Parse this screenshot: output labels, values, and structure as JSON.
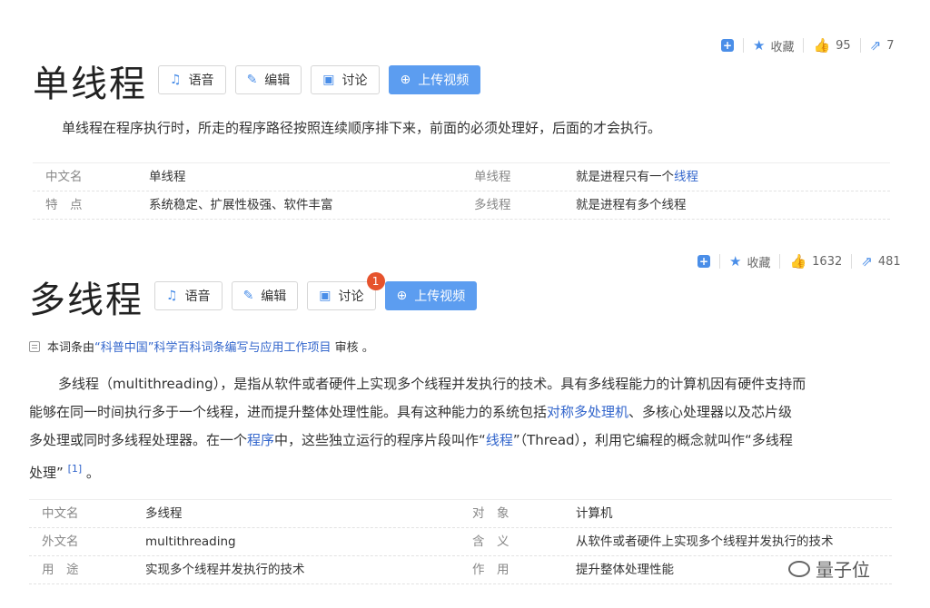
{
  "entry1": {
    "title": "单线程",
    "actions": {
      "add": "+",
      "fav_label": "收藏",
      "like_count": "95",
      "share_count": "7"
    },
    "buttons": {
      "voice": "语音",
      "edit": "编辑",
      "discuss": "讨论",
      "upload": "上传视频"
    },
    "summary": "单线程在程序执行时，所走的程序路径按照连续顺序排下来，前面的必须处理好，后面的才会执行。",
    "info": [
      {
        "k1": "中文名",
        "v1": "单线程",
        "k2": "单线程",
        "v2_pre": "就是进程只有一个",
        "v2_link": "线程"
      },
      {
        "k1": "特　点",
        "v1": "系统稳定、扩展性极强、软件丰富",
        "k2": "多线程",
        "v2_pre": "就是进程有多个线程",
        "v2_link": ""
      }
    ]
  },
  "entry2": {
    "title": "多线程",
    "actions": {
      "add": "+",
      "fav_label": "收藏",
      "like_count": "1632",
      "share_count": "481"
    },
    "buttons": {
      "voice": "语音",
      "edit": "编辑",
      "discuss": "讨论",
      "discuss_badge": "1",
      "upload": "上传视频"
    },
    "notice": {
      "pre": "本词条由",
      "link": "“科普中国”科学百科词条编写与应用工作项目",
      "post": " 审核 。"
    },
    "para": {
      "p1": "多线程（multithreading），是指从软件或者硬件上实现多个线程并发执行的技术。具有多线程能力的计算机因有硬件支持而",
      "p2a": "能够在同一时间执行多于一个线程，进而提升整体处理性能。具有这种能力的系统包括",
      "p2link": "对称多处理机",
      "p2b": "、多核心处理器以及芯片级",
      "p3a": "多处理或同时多线程处理器。在一个",
      "p3link1": "程序",
      "p3b": "中，这些独立运行的程序片段叫作“",
      "p3link2": "线程",
      "p3c": "”（Thread），利用它编程的概念就叫作“多线程",
      "p4": "处理”",
      "ref": "[1]",
      "p4end": " 。"
    },
    "info": [
      {
        "k1": "中文名",
        "v1": "多线程",
        "k2": "对　象",
        "v2": "计算机",
        "v2_is_link": true
      },
      {
        "k1": "外文名",
        "v1": "multithreading",
        "k2": "含　义",
        "v2": "从软件或者硬件上实现多个线程并发执行的技术"
      },
      {
        "k1": "用　途",
        "v1": "实现多个线程并发执行的技术",
        "k2": "作　用",
        "v2": "提升整体处理性能"
      }
    ]
  },
  "watermark": "量子位",
  "colors": {
    "accent": "#4a8ee8",
    "link": "#3366cc",
    "primary_button": "#5c9df0",
    "badge": "#e6532d"
  }
}
